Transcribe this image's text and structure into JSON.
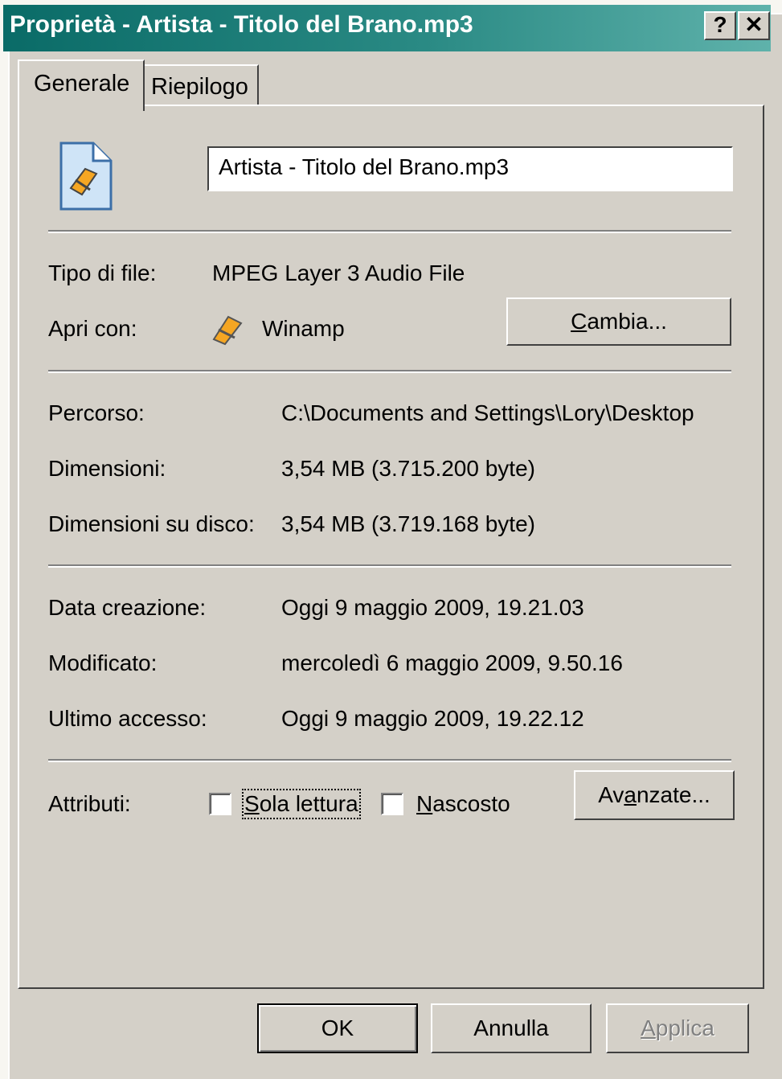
{
  "window": {
    "title": "Proprietà - Artista - Titolo del Brano.mp3"
  },
  "titlebar_buttons": {
    "help": "?",
    "close": "✕"
  },
  "tabs": [
    {
      "label": "Generale"
    },
    {
      "label": "Riepilogo"
    }
  ],
  "file": {
    "name": "Artista - Titolo del Brano.mp3"
  },
  "type": {
    "label": "Tipo di file:",
    "value": "MPEG Layer 3 Audio File"
  },
  "open_with": {
    "label": "Apri con:",
    "app": "Winamp",
    "button_pre": "",
    "button_accel": "C",
    "button_post": "ambia..."
  },
  "details": [
    {
      "label": "Percorso:",
      "value": "C:\\Documents and Settings\\Lory\\Desktop"
    },
    {
      "label": "Dimensioni:",
      "value": "3,54 MB (3.715.200 byte)"
    },
    {
      "label": "Dimensioni su disco:",
      "value": "3,54 MB (3.719.168 byte)"
    }
  ],
  "dates": [
    {
      "label": "Data creazione:",
      "value": "Oggi 9 maggio 2009, 19.21.03"
    },
    {
      "label": "Modificato:",
      "value": "mercoledì 6 maggio 2009, 9.50.16"
    },
    {
      "label": "Ultimo accesso:",
      "value": "Oggi 9 maggio 2009, 19.22.12"
    }
  ],
  "attributes": {
    "label": "Attributi:",
    "readonly": {
      "accel": "S",
      "rest": "ola lettura",
      "checked": false
    },
    "hidden": {
      "accel": "N",
      "rest": "ascosto",
      "checked": false
    },
    "advanced_pre": "Av",
    "advanced_accel": "a",
    "advanced_post": "nzate..."
  },
  "footer": {
    "ok": "OK",
    "cancel": "Annulla",
    "apply_accel": "A",
    "apply_rest": "pplica"
  },
  "colors": {
    "title_bar": "#0a6b67",
    "face": "#d4d0c8",
    "disabled_text": "#808080"
  },
  "icons": {
    "file": "winamp-file-icon",
    "app": "winamp-icon"
  }
}
